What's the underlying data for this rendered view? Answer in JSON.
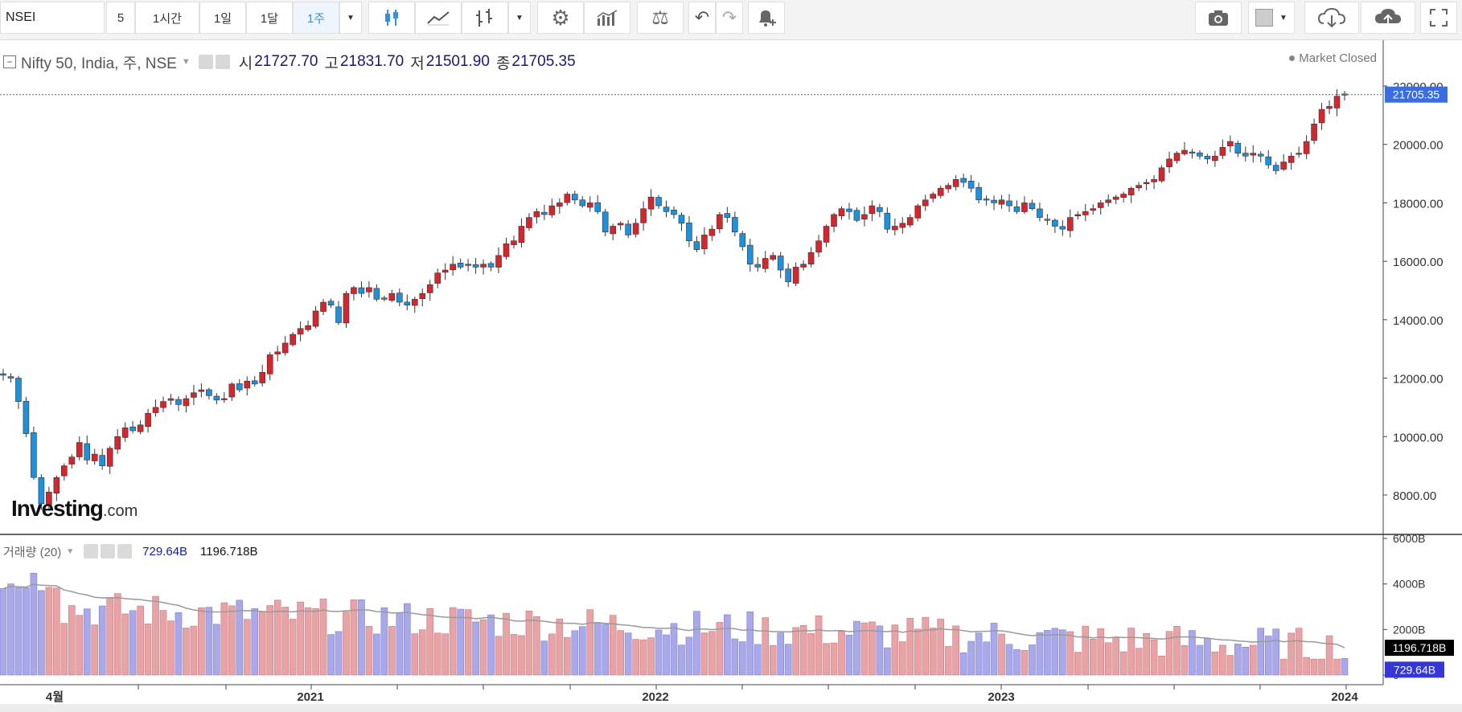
{
  "toolbar": {
    "symbol": "NSEI",
    "intervals": [
      "5",
      "1시간",
      "1일",
      "1달",
      "1주"
    ],
    "active_interval": "1주",
    "icons": [
      "candles-icon",
      "line-chart-icon",
      "bars-icon",
      "gear-icon",
      "indicators-icon",
      "compare-icon",
      "undo-icon",
      "redo-icon",
      "add-alert-icon",
      "camera-icon",
      "color-box-icon",
      "cloud-download-icon",
      "cloud-upload-icon",
      "fullscreen-icon"
    ]
  },
  "legend": {
    "title": "Nifty 50, India, 주, NSE",
    "open_label": "시",
    "open": "21727.70",
    "high_label": "고",
    "high": "21831.70",
    "low_label": "저",
    "low": "21501.90",
    "close_label": "종",
    "close": "21705.35"
  },
  "market_status": "Market Closed",
  "volume_legend": {
    "title": "거래량 (20)",
    "volume": "729.64B",
    "ma": "1196.718B"
  },
  "logo": {
    "main": "Investing",
    "suffix": ".com"
  },
  "colors": {
    "up": "#d6262d",
    "down": "#1e90dc",
    "vol_up": "#e8a3a6",
    "vol_down": "#a9a9ea",
    "price_tag": "#3a6de0",
    "volume_tag": "#3636d6",
    "ma_tag": "#000000",
    "ma_line": "#999999"
  },
  "chart_data": {
    "type": "candlestick",
    "title": "Nifty 50, India, 주, NSE",
    "last_price": 21705.35,
    "price_ticks": [
      8000,
      10000,
      12000,
      14000,
      16000,
      18000,
      20000,
      22000
    ],
    "price_tick_labels": [
      "8000.00",
      "10000.00",
      "12000.00",
      "14000.00",
      "16000.00",
      "18000.00",
      "20000.00",
      "22000.00"
    ],
    "x_labels": [
      "4월",
      "2021",
      "2022",
      "2023",
      "2024"
    ],
    "close_path": [
      12100,
      12000,
      11200,
      10100,
      8600,
      7700,
      8100,
      8600,
      9000,
      9300,
      9800,
      9200,
      9400,
      9000,
      9600,
      10000,
      10300,
      10200,
      10400,
      10800,
      11000,
      11200,
      11300,
      11100,
      11300,
      11500,
      11600,
      11400,
      11250,
      11300,
      11800,
      11600,
      11900,
      11800,
      12200,
      12800,
      12900,
      13200,
      13500,
      13700,
      13800,
      14300,
      14600,
      14500,
      13900,
      14900,
      15100,
      14900,
      15100,
      14700,
      14700,
      14900,
      14600,
      14500,
      14700,
      14900,
      15200,
      15600,
      15700,
      15900,
      15800,
      15900,
      15800,
      15900,
      15800,
      16200,
      16600,
      16700,
      17200,
      17500,
      17700,
      17600,
      17900,
      18000,
      18300,
      18100,
      17900,
      18000,
      17700,
      17000,
      17200,
      17300,
      16900,
      17300,
      17800,
      18200,
      17900,
      17700,
      17600,
      17300,
      16700,
      16400,
      16900,
      17100,
      17600,
      17500,
      17000,
      16500,
      15900,
      15800,
      16100,
      16200,
      15700,
      15300,
      15800,
      15900,
      16300,
      16700,
      17200,
      17600,
      17800,
      17700,
      17400,
      17600,
      17900,
      17700,
      17100,
      17200,
      17300,
      17500,
      17900,
      18100,
      18300,
      18500,
      18600,
      18800,
      18700,
      18500,
      18100,
      18100,
      18000,
      18100,
      17900,
      17700,
      18000,
      17800,
      17500,
      17400,
      17200,
      17100,
      17500,
      17600,
      17700,
      17800,
      18000,
      18100,
      18200,
      18300,
      18500,
      18600,
      18700,
      18800,
      19200,
      19500,
      19700,
      19800,
      19700,
      19600,
      19500,
      19600,
      19900,
      20100,
      19700,
      19600,
      19700,
      19600,
      19300,
      19100,
      19400,
      19600,
      19700,
      20100,
      20700,
      21200,
      21300,
      21650,
      21705
    ]
  }
}
